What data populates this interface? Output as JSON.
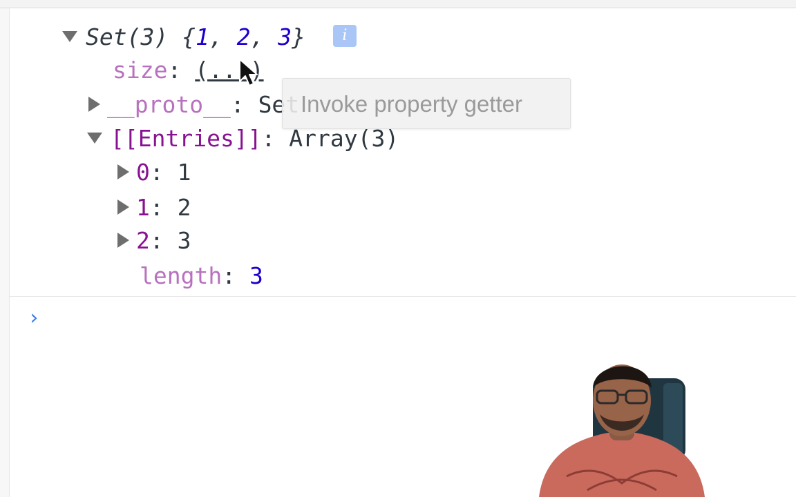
{
  "set_header": {
    "label": "Set(3)",
    "brace_open": "{",
    "brace_close": "}",
    "values": [
      "1",
      "2",
      "3"
    ],
    "separator": ", ",
    "info_badge": "i"
  },
  "size_row": {
    "key": "size",
    "colon": ": ",
    "value": "(...)"
  },
  "proto_row": {
    "key": "__proto__",
    "colon": ": ",
    "value": "Set"
  },
  "entries_row": {
    "key": "[[Entries]]",
    "colon": ": ",
    "value": "Array(3)"
  },
  "entries": [
    {
      "index": "0",
      "colon": ": ",
      "value": "1"
    },
    {
      "index": "1",
      "colon": ": ",
      "value": "2"
    },
    {
      "index": "2",
      "colon": ": ",
      "value": "3"
    }
  ],
  "length_row": {
    "key": "length",
    "colon": ": ",
    "value": "3"
  },
  "tooltip": {
    "text": "Invoke property getter"
  },
  "prompt": {
    "symbol": "›",
    "value": ""
  },
  "icons": {
    "expanded": "triangle-down-icon",
    "collapsed": "triangle-right-icon",
    "info": "info-icon",
    "cursor": "mouse-pointer-icon",
    "prompt": "chevron-right-icon"
  },
  "colors": {
    "number": "#1c00cf",
    "key_own": "#881391",
    "key_internal": "#b871be",
    "prompt": "#367cf1",
    "info_badge": "#aac6f6"
  }
}
